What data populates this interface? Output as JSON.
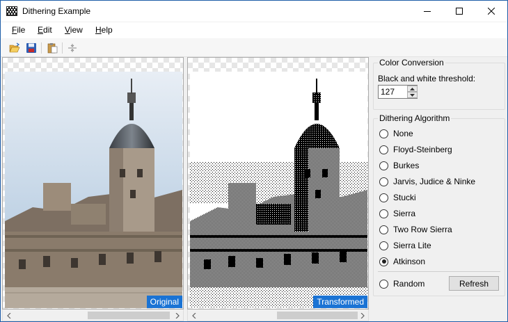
{
  "window": {
    "title": "Dithering Example"
  },
  "menu": [
    {
      "key": "F",
      "rest": "ile"
    },
    {
      "key": "E",
      "rest": "dit"
    },
    {
      "key": "V",
      "rest": "iew"
    },
    {
      "key": "H",
      "rest": "elp"
    }
  ],
  "toolbar": {
    "icons": [
      "open-icon",
      "save-icon",
      "paste-icon",
      "split-icon"
    ]
  },
  "original": {
    "label": "Original"
  },
  "transformed": {
    "label": "Transformed"
  },
  "color_conversion": {
    "title": "Color Conversion",
    "threshold_label": "Black and white threshold:",
    "threshold_value": "127"
  },
  "dithering": {
    "title": "Dithering Algorithm",
    "options": [
      {
        "label": "None",
        "selected": false
      },
      {
        "label": "Floyd-Steinberg",
        "selected": false
      },
      {
        "label": "Burkes",
        "selected": false
      },
      {
        "label": "Jarvis, Judice & Ninke",
        "selected": false
      },
      {
        "label": "Stucki",
        "selected": false
      },
      {
        "label": "Sierra",
        "selected": false
      },
      {
        "label": "Two Row Sierra",
        "selected": false
      },
      {
        "label": "Sierra Lite",
        "selected": false
      },
      {
        "label": "Atkinson",
        "selected": true
      }
    ],
    "random_label": "Random",
    "random_selected": false,
    "refresh_label": "Refresh"
  },
  "colors": {
    "accent": "#1a73d4",
    "titlebar_border": "#1e5da8"
  }
}
